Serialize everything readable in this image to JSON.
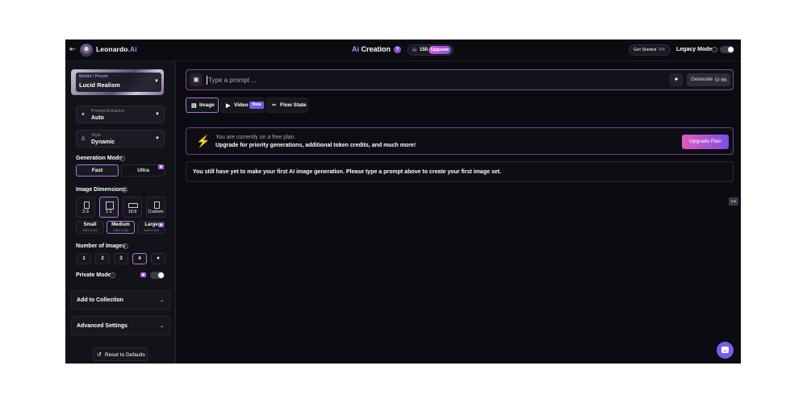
{
  "header": {
    "brand_name": "Leonardo",
    "brand_suffix": ".Ai",
    "title_prefix": "Ai",
    "title_main": " Creation",
    "help_mark": "?",
    "token_icon": "token-icon",
    "token_count": "150",
    "upgrade_label": "Upgrade",
    "get_started_label": "Get Started",
    "get_started_progress": "0/4",
    "legacy_mode_label": "Legacy Mode",
    "legacy_mode_enabled": false
  },
  "sidebar": {
    "model": {
      "label": "Model / Preset",
      "value": "Lucid Realism"
    },
    "prompt_enhance": {
      "label": "Prompt Enhance",
      "value": "Auto"
    },
    "style": {
      "label": "Style",
      "value": "Dynamic"
    },
    "generation_mode": {
      "label": "Generation Mode",
      "options": [
        "Fast",
        "Ultra"
      ],
      "selected": "Fast"
    },
    "image_dimensions": {
      "label": "Image Dimensions",
      "ratios": [
        "2:3",
        "1:1",
        "16:9",
        "Custom"
      ],
      "selected_ratio": "1:1",
      "sizes": [
        {
          "name": "Small",
          "dims": "1024×1024"
        },
        {
          "name": "Medium",
          "dims": "1360×1360"
        },
        {
          "name": "Large",
          "dims": "1640×1640"
        }
      ],
      "selected_size": "Medium"
    },
    "number_of_images": {
      "label": "Number of Images",
      "options": [
        "1",
        "2",
        "3",
        "4"
      ],
      "selected": "4"
    },
    "private_mode": {
      "label": "Private Mode",
      "enabled": false
    },
    "add_to_collection": "Add to Collection",
    "advanced_settings": "Advanced Settings",
    "reset_label": "Reset to Defaults"
  },
  "main": {
    "prompt": {
      "placeholder": "Type a prompt ...",
      "value": ""
    },
    "generate": {
      "label": "Generate",
      "cost": "66"
    },
    "tabs": [
      {
        "label": "Image",
        "active": true
      },
      {
        "label": "Video",
        "badge": "New",
        "active": false
      },
      {
        "label": "Flow State",
        "active": false
      }
    ],
    "plan_banner": {
      "line1": "You are currently on a free plan.",
      "line2": "Upgrade for priority generations, additional token credits, and much more!",
      "button": "Upgrade Plan"
    },
    "empty_message": "You still have yet to make your first AI image generation. Please type a prompt above to create your first image set."
  },
  "colors": {
    "background": "#0b0c11",
    "sidebar": "#121319",
    "accent_purple": "#b76fe6",
    "brand_ai": "#b98bf2",
    "bolt_orange": "#f39b2d",
    "chat_fab": "#7a5cf0"
  }
}
